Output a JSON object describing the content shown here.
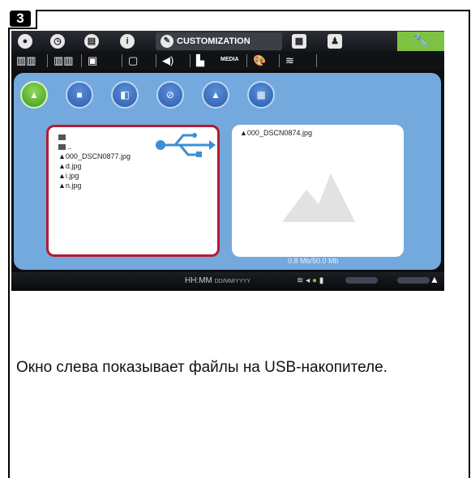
{
  "step": {
    "number": "3"
  },
  "topbar": {
    "icons": [
      "water-drop",
      "clock",
      "book",
      "info",
      "folder-person"
    ],
    "active_tab_label": "CUSTOMIZATION",
    "settings_icon": "wrench"
  },
  "subbar": {
    "media_label": "MEDIA"
  },
  "left_panel": {
    "files": [
      {
        "name": "",
        "type": "folder"
      },
      {
        "name": "..",
        "type": "folder"
      },
      {
        "name": "000_DSCN0877.jpg",
        "type": "image"
      },
      {
        "name": "d.jpg",
        "type": "image"
      },
      {
        "name": "i.jpg",
        "type": "image"
      },
      {
        "name": "n.jpg",
        "type": "image"
      }
    ],
    "highlight_color": "#b31b34"
  },
  "right_panel": {
    "file_name": "000_DSCN0874.jpg",
    "usage": "0.8 Mb/50.0 Mb"
  },
  "bottombar": {
    "time": "HH:MM",
    "date_format": "DD/MM/YYYY"
  },
  "caption": "Окно слева показывает файлы на USB-накопителе.",
  "colors": {
    "accent_green": "#7fc142",
    "panel_blue": "#74a9de",
    "circle_blue": "#2a5cae"
  }
}
